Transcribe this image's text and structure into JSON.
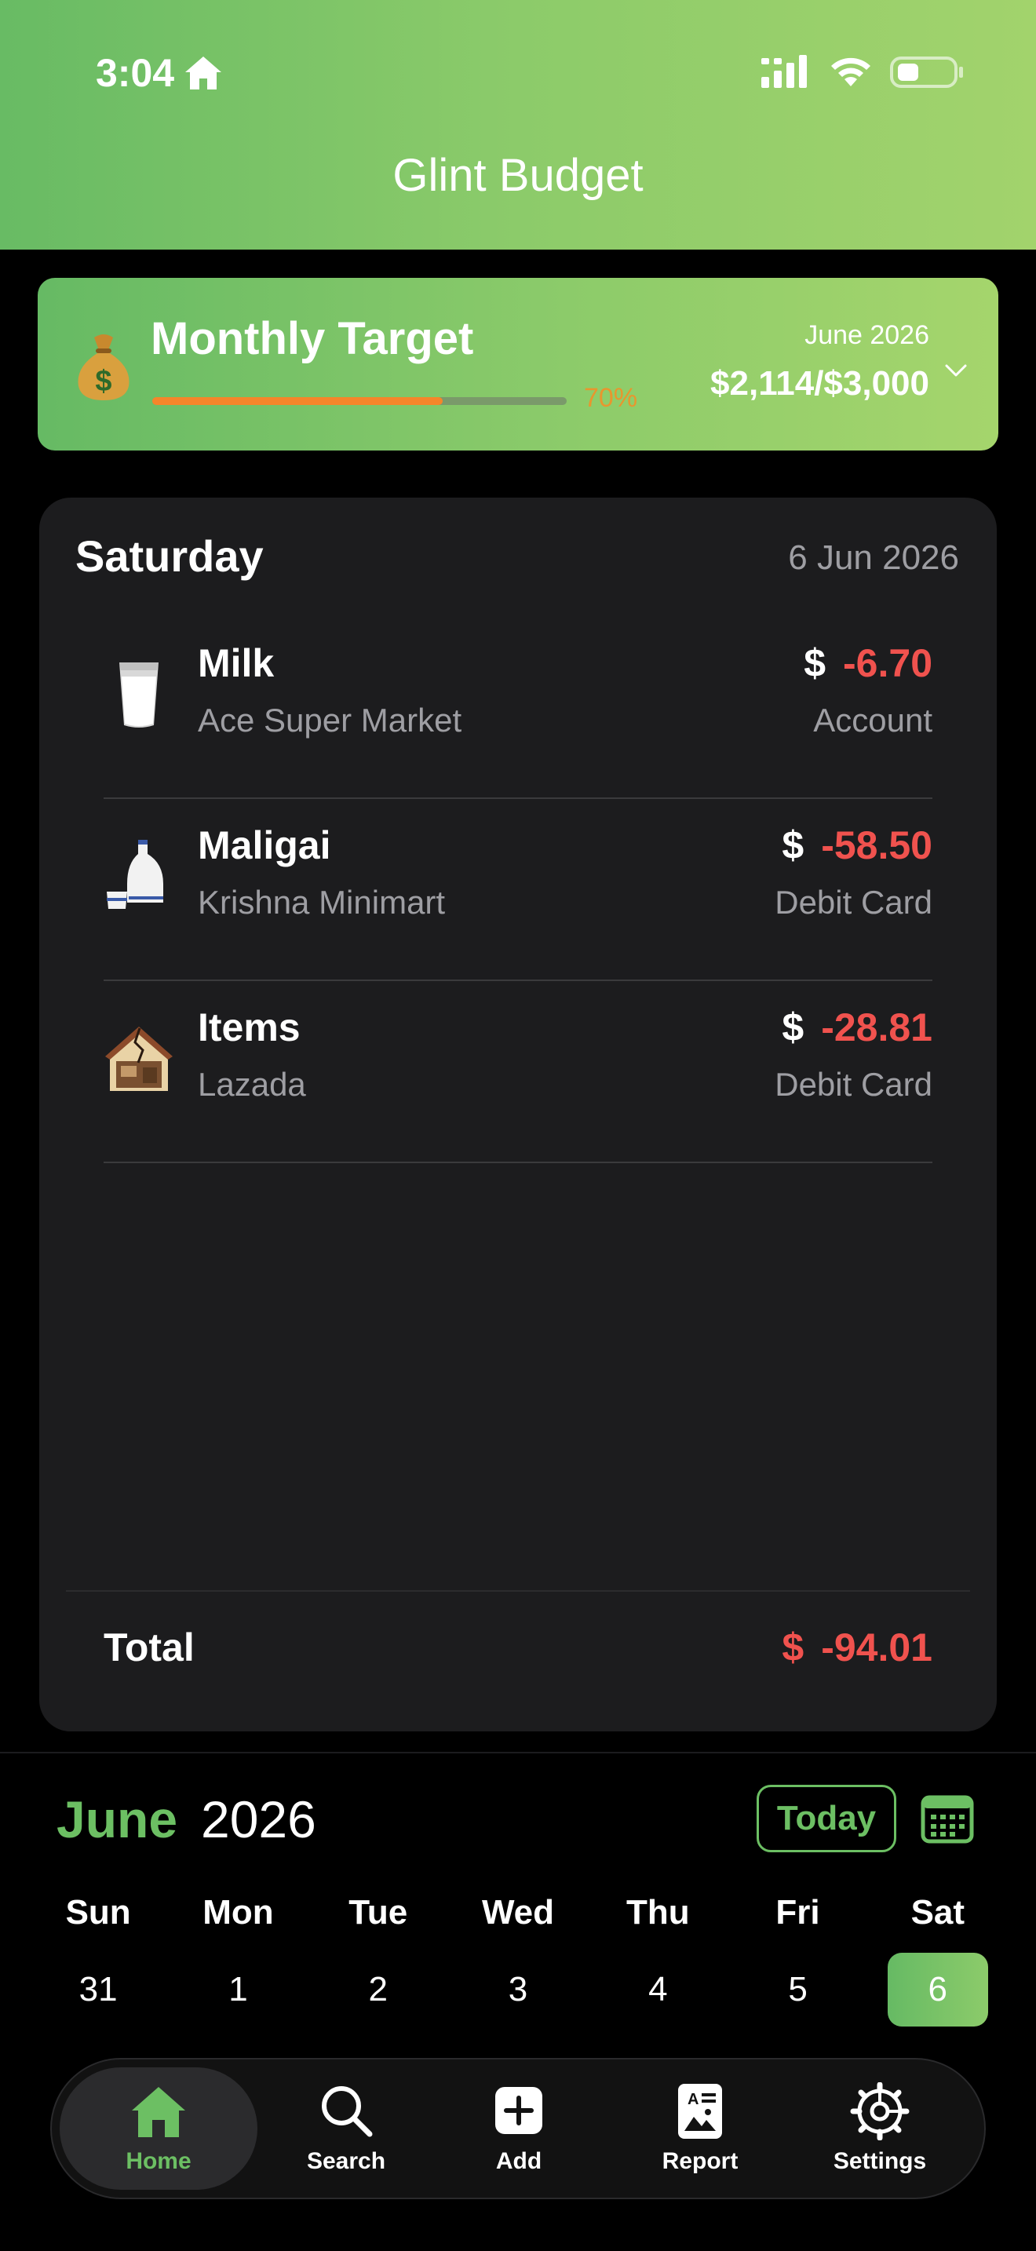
{
  "status_bar": {
    "time": "3:04",
    "home_icon": "home-icon",
    "signal_icon": "signal-icon",
    "wifi_icon": "wifi-icon",
    "battery_icon": "battery-icon"
  },
  "header": {
    "title": "Glint Budget",
    "gradient_start": "#68bb64",
    "gradient_end": "#a2d36c"
  },
  "target": {
    "icon": "money-bag-icon",
    "title": "Monthly Target",
    "progress_fraction": 0.7,
    "progress_label": "70%",
    "month": "June 2026",
    "amount": "$2,114/$3,000",
    "chevron": "chevron-down-icon"
  },
  "day": {
    "name": "Saturday",
    "date": "6 Jun 2026",
    "transactions": [
      {
        "icon": "milk-glass-icon",
        "name": "Milk",
        "store": "Ace Super Market",
        "currency": "$",
        "amount": "-6.70",
        "method": "Account"
      },
      {
        "icon": "sake-bottle-icon",
        "name": "Maligai",
        "store": "Krishna Minimart",
        "currency": "$",
        "amount": "-58.50",
        "method": "Debit Card"
      },
      {
        "icon": "house-icon",
        "name": "Items",
        "store": "Lazada",
        "currency": "$",
        "amount": "-28.81",
        "method": "Debit Card"
      }
    ],
    "total_label": "Total",
    "total_currency": "$",
    "total_amount": "-94.01"
  },
  "calendar": {
    "month": "June",
    "year": "2026",
    "today_label": "Today",
    "calendar_icon": "calendar-icon",
    "weekdays": [
      "Sun",
      "Mon",
      "Tue",
      "Wed",
      "Thu",
      "Fri",
      "Sat"
    ],
    "days": [
      "31",
      "1",
      "2",
      "3",
      "4",
      "5",
      "6"
    ],
    "selected_day": "6",
    "accent": "#6cbf63"
  },
  "tabbar": {
    "tabs": [
      {
        "icon": "home-icon",
        "label": "Home",
        "active": true
      },
      {
        "icon": "search-icon",
        "label": "Search",
        "active": false
      },
      {
        "icon": "add-icon",
        "label": "Add",
        "active": false
      },
      {
        "icon": "report-icon",
        "label": "Report",
        "active": false
      },
      {
        "icon": "gear-icon",
        "label": "Settings",
        "active": false
      }
    ]
  },
  "colors": {
    "negative": "#f0524e",
    "progress": "#f5862a",
    "card_bg": "#1c1c1e",
    "secondary_text": "#9e9ea3"
  }
}
